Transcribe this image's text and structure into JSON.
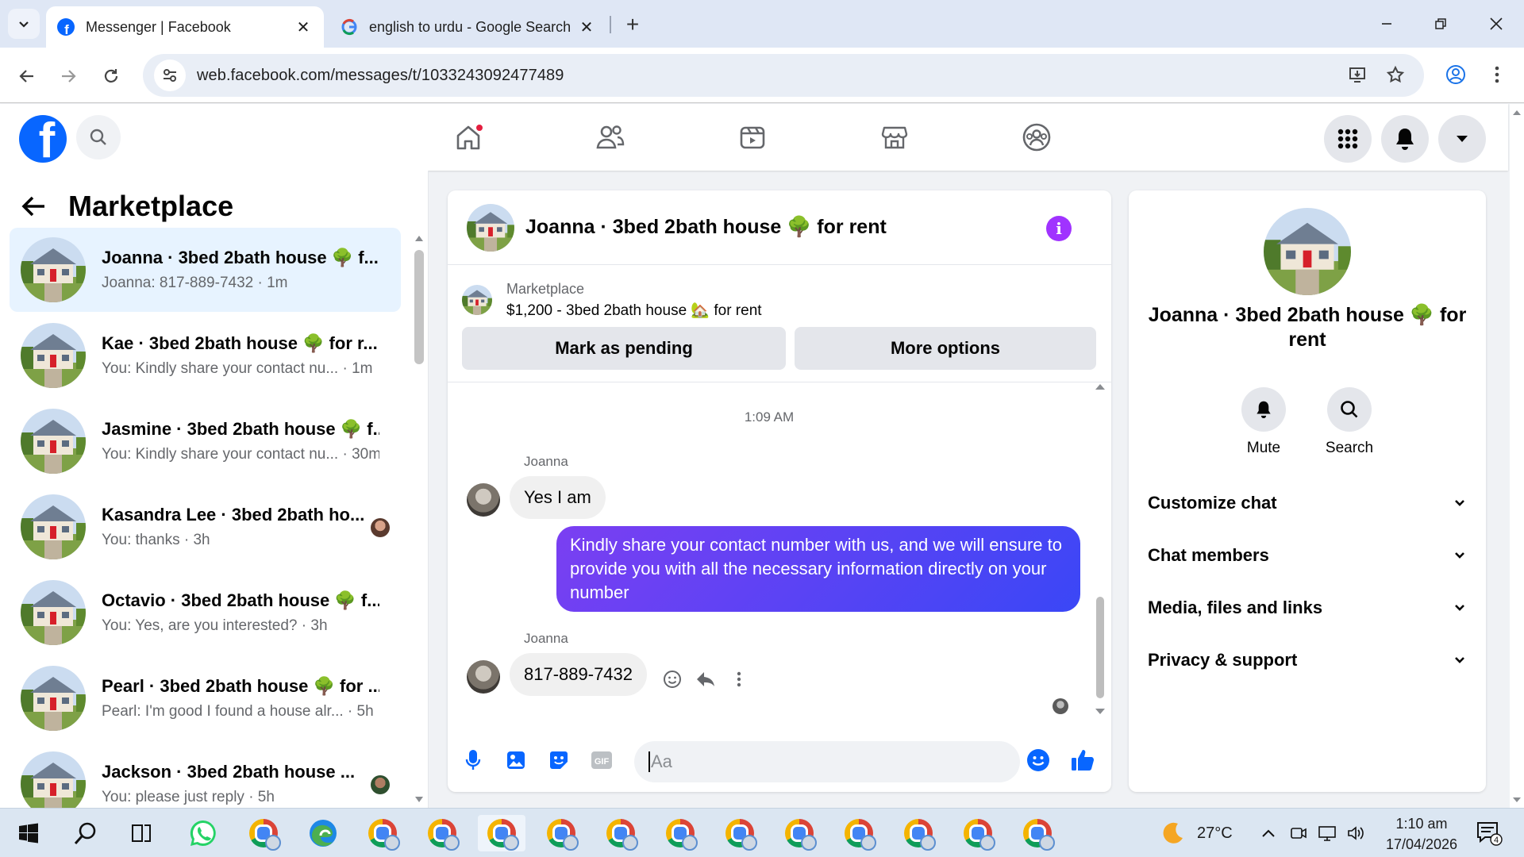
{
  "browser": {
    "tabs": [
      {
        "title": "Messenger | Facebook",
        "icon": "facebook-icon",
        "active": true
      },
      {
        "title": "english to urdu - Google Search",
        "icon": "google-icon",
        "active": false
      }
    ],
    "url": "web.facebook.com/messages/t/1033243092477489"
  },
  "colors": {
    "facebook_blue": "#0866ff",
    "outgoing_bubble_start": "#7b3ff2",
    "outgoing_bubble_end": "#3a47f6",
    "selected_row": "#e7f3ff",
    "info_purple": "#a033ff"
  },
  "left": {
    "title": "Marketplace",
    "conversations": [
      {
        "title": "Joanna · 3bed 2bath house 🌳 f...",
        "sub": "Joanna: 817-889-7432 · 1m",
        "selected": true
      },
      {
        "title": "Kae · 3bed 2bath house 🌳 for r...",
        "sub": "You: Kindly share your contact nu...  · 1m"
      },
      {
        "title": "Jasmine · 3bed 2bath house 🌳 f...",
        "sub": "You: Kindly share your contact nu...  · 30m"
      },
      {
        "title": "Kasandra Lee · 3bed 2bath ho...",
        "sub": "You: thanks · 3h"
      },
      {
        "title": "Octavio · 3bed 2bath house 🌳 f...",
        "sub": "You: Yes, are you interested? · 3h"
      },
      {
        "title": "Pearl · 3bed 2bath house 🌳 for ...",
        "sub": "Pearl: I'm good I found a house alr...  · 5h"
      },
      {
        "title": "Jackson · 3bed 2bath house ...",
        "sub": "You: please just reply · 5h"
      }
    ]
  },
  "chat": {
    "title": "Joanna · 3bed 2bath house 🌳 for rent",
    "listing_category": "Marketplace",
    "listing_name": "$1,200 - 3bed 2bath house 🏡 for rent",
    "mark_pending": "Mark as pending",
    "more_options": "More options",
    "time": "1:09 AM",
    "messages": [
      {
        "sender": "Joanna",
        "text": "Yes I am"
      },
      {
        "sender": "You",
        "text": "Kindly share your contact number with us, and we will ensure to provide you with all the necessary information directly on your number"
      },
      {
        "sender": "Joanna",
        "text": "817-889-7432"
      }
    ],
    "composer_placeholder": "Aa"
  },
  "right": {
    "name": "Joanna · 3bed 2bath house 🌳 for rent",
    "mute": "Mute",
    "search": "Search",
    "sections": [
      "Customize chat",
      "Chat members",
      "Media, files and links",
      "Privacy & support"
    ]
  },
  "taskbar": {
    "temperature": "27°C",
    "time": "1:10 am",
    "date": "17/04/2026",
    "notifications": "4"
  }
}
